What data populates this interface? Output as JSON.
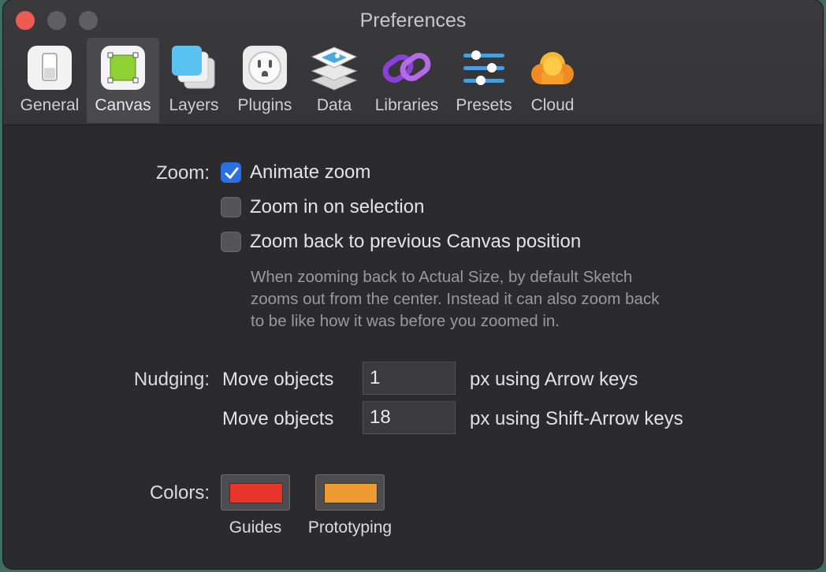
{
  "window": {
    "title": "Preferences"
  },
  "toolbar": {
    "items": [
      {
        "label": "General",
        "icon": "general-switch-icon"
      },
      {
        "label": "Canvas",
        "icon": "canvas-icon"
      },
      {
        "label": "Layers",
        "icon": "layers-icon"
      },
      {
        "label": "Plugins",
        "icon": "plugins-icon"
      },
      {
        "label": "Data",
        "icon": "data-icon"
      },
      {
        "label": "Libraries",
        "icon": "libraries-icon"
      },
      {
        "label": "Presets",
        "icon": "presets-icon"
      },
      {
        "label": "Cloud",
        "icon": "cloud-icon"
      }
    ],
    "selected": "Canvas"
  },
  "zoom": {
    "label": "Zoom:",
    "options": [
      {
        "label": "Animate zoom",
        "checked": true
      },
      {
        "label": "Zoom in on selection",
        "checked": false
      },
      {
        "label": "Zoom back to previous Canvas position",
        "checked": false
      }
    ],
    "help_lines": [
      "When zooming back to Actual Size, by default Sketch",
      "zooms out from the center. Instead it can also zoom back",
      "to be like how it was before you zoomed in."
    ]
  },
  "nudging": {
    "label": "Nudging:",
    "rows": [
      {
        "prefix": "Move objects",
        "value": "1",
        "suffix": "px using Arrow keys"
      },
      {
        "prefix": "Move objects",
        "value": "18",
        "suffix": "px using Shift-Arrow keys"
      }
    ]
  },
  "colors": {
    "label": "Colors:",
    "swatches": [
      {
        "label": "Guides",
        "color": "#e8352b"
      },
      {
        "label": "Prototyping",
        "color": "#ee9a33"
      }
    ]
  }
}
